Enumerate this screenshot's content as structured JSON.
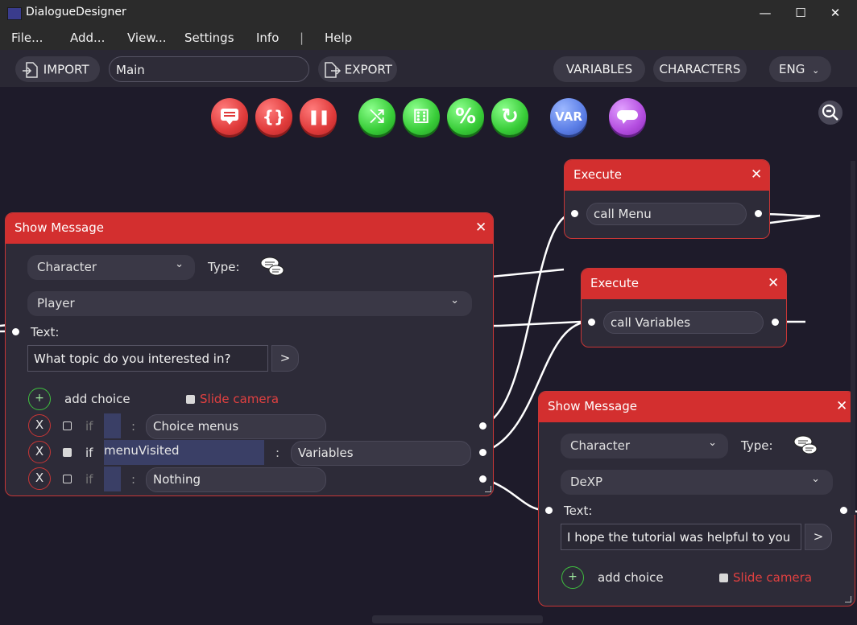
{
  "window": {
    "title": "DialogueDesigner",
    "minimize": "—",
    "maximize": "☐",
    "close": "✕"
  },
  "menu": [
    "File...",
    "Add...",
    "View...",
    "Settings",
    "Info",
    "|",
    "Help"
  ],
  "toolbar": {
    "import_label": "IMPORT",
    "file_name": "Main",
    "export_label": "EXPORT",
    "variables_label": "VARIABLES",
    "characters_label": "CHARACTERS",
    "language": "ENG"
  },
  "tools": [
    {
      "name": "show-message-tool",
      "color": "red",
      "glyph": "▤"
    },
    {
      "name": "execute-tool",
      "color": "red",
      "glyph": "{}"
    },
    {
      "name": "wait-tool",
      "color": "red",
      "glyph": "❚❚"
    },
    {
      "name": "branch-tool",
      "color": "green",
      "glyph": "⤭"
    },
    {
      "name": "random-tool",
      "color": "green",
      "glyph": "⚅"
    },
    {
      "name": "chance-tool",
      "color": "green",
      "glyph": "%"
    },
    {
      "name": "repeat-tool",
      "color": "green",
      "glyph": "↻"
    },
    {
      "name": "variable-tool",
      "color": "blue",
      "glyph": "VAR"
    },
    {
      "name": "comment-tool",
      "color": "purple",
      "glyph": "💬"
    }
  ],
  "nodes": {
    "execute_menu": {
      "title": "Execute",
      "close": "✕",
      "code": "call Menu"
    },
    "execute_variables": {
      "title": "Execute",
      "close": "✕",
      "code": "call Variables"
    },
    "show_message_1": {
      "title": "Show Message",
      "close": "✕",
      "character_dropdown": "Character",
      "type_label": "Type:",
      "character_value": "Player",
      "text_label": "Text:",
      "text_value": "What topic do you interested in?",
      "arrow": ">",
      "add_choice": "add choice",
      "add_choice_icon": "+",
      "slide_camera": "Slide camera",
      "choices": [
        {
          "remove": "X",
          "checked": false,
          "if": "if",
          "condition": "",
          "colon": ":",
          "text": "Choice menus"
        },
        {
          "remove": "X",
          "checked": true,
          "if": "if",
          "condition": "menuVisited",
          "colon": ":",
          "text": "Variables"
        },
        {
          "remove": "X",
          "checked": false,
          "if": "if",
          "condition": "",
          "colon": ":",
          "text": "Nothing"
        }
      ]
    },
    "show_message_2": {
      "title": "Show Message",
      "close": "✕",
      "character_dropdown": "Character",
      "type_label": "Type:",
      "character_value": "DeXP",
      "text_label": "Text:",
      "text_value": "I hope the tutorial was helpful to you",
      "arrow": ">",
      "add_choice": "add choice",
      "add_choice_icon": "+",
      "slide_camera": "Slide camera"
    }
  },
  "colors": {
    "accent_red": "#d32f2f",
    "green": "#38cc38",
    "canvas": "#1e1b2a"
  }
}
